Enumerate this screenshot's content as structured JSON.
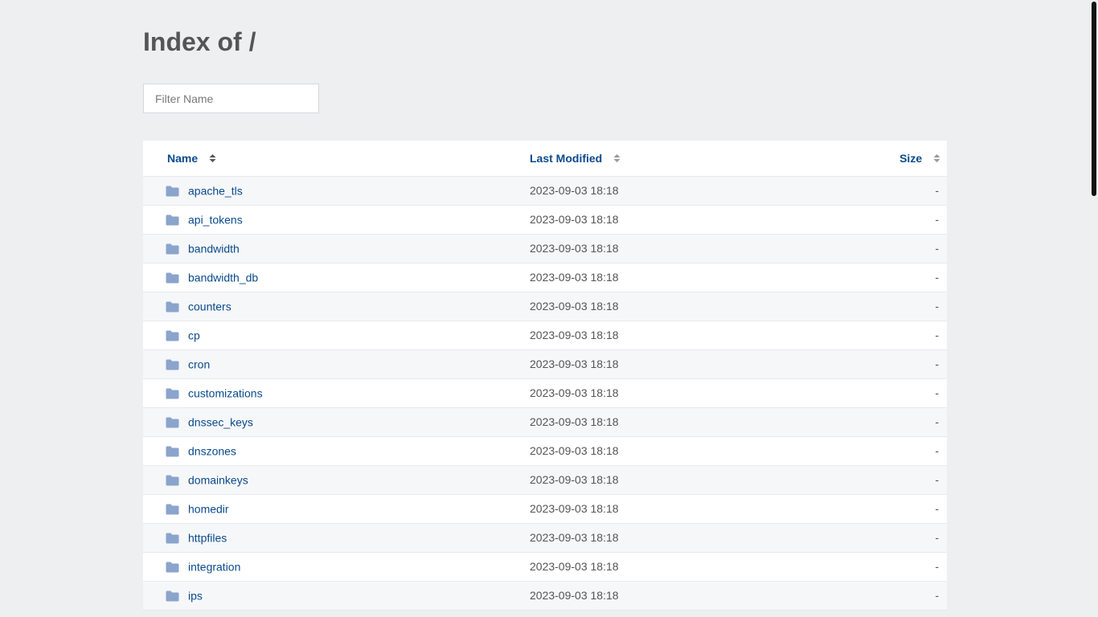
{
  "page": {
    "title": "Index of /"
  },
  "filter": {
    "placeholder": "Filter Name"
  },
  "table": {
    "headers": {
      "name": "Name",
      "last_modified": "Last Modified",
      "size": "Size"
    },
    "rows": [
      {
        "name": "apache_tls",
        "modified": "2023-09-03 18:18",
        "size": "-"
      },
      {
        "name": "api_tokens",
        "modified": "2023-09-03 18:18",
        "size": "-"
      },
      {
        "name": "bandwidth",
        "modified": "2023-09-03 18:18",
        "size": "-"
      },
      {
        "name": "bandwidth_db",
        "modified": "2023-09-03 18:18",
        "size": "-"
      },
      {
        "name": "counters",
        "modified": "2023-09-03 18:18",
        "size": "-"
      },
      {
        "name": "cp",
        "modified": "2023-09-03 18:18",
        "size": "-"
      },
      {
        "name": "cron",
        "modified": "2023-09-03 18:18",
        "size": "-"
      },
      {
        "name": "customizations",
        "modified": "2023-09-03 18:18",
        "size": "-"
      },
      {
        "name": "dnssec_keys",
        "modified": "2023-09-03 18:18",
        "size": "-"
      },
      {
        "name": "dnszones",
        "modified": "2023-09-03 18:18",
        "size": "-"
      },
      {
        "name": "domainkeys",
        "modified": "2023-09-03 18:18",
        "size": "-"
      },
      {
        "name": "homedir",
        "modified": "2023-09-03 18:18",
        "size": "-"
      },
      {
        "name": "httpfiles",
        "modified": "2023-09-03 18:18",
        "size": "-"
      },
      {
        "name": "integration",
        "modified": "2023-09-03 18:18",
        "size": "-"
      },
      {
        "name": "ips",
        "modified": "2023-09-03 18:18",
        "size": "-"
      }
    ]
  },
  "icons": {
    "row_icon": "folder-icon",
    "sort_icon": "sort-icon"
  },
  "colors": {
    "link": "#0a4a8c",
    "folder": "#8aa4cc",
    "background": "#eeeff1"
  }
}
